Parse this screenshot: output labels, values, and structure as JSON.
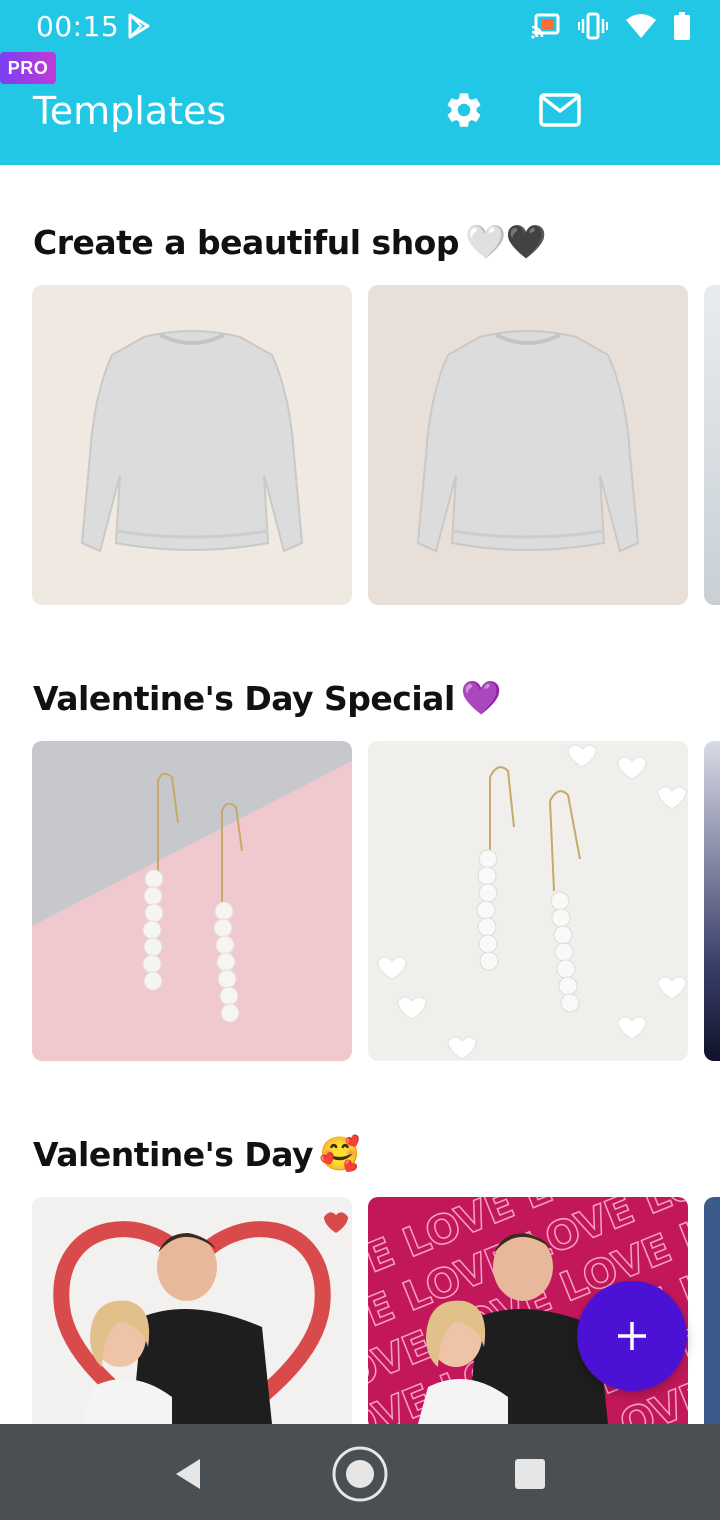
{
  "status_bar": {
    "time": "00:15",
    "icons": [
      "play-store-icon",
      "cast-icon",
      "vibrate-icon",
      "wifi-icon",
      "battery-icon"
    ]
  },
  "app_bar": {
    "title": "Templates",
    "pro_label": "PRO",
    "icons": [
      "settings-icon",
      "mail-icon"
    ]
  },
  "sections": [
    {
      "title": "Create a beautiful shop",
      "emoji": "🤍🖤"
    },
    {
      "title": "Valentine's Day Special",
      "emoji": "💜"
    },
    {
      "title": "Valentine's Day",
      "emoji": "🥰"
    }
  ],
  "cards": {
    "valentine_card2_text": "LOVE LOVE LOVE LOVE"
  },
  "fab": {
    "label": "+"
  },
  "colors": {
    "primary": "#22c7e6",
    "fab": "#4b12d6",
    "pro_gradient_start": "#7b3ff2",
    "pro_gradient_end": "#c13ad8",
    "nav_bar": "#4a4f54"
  }
}
